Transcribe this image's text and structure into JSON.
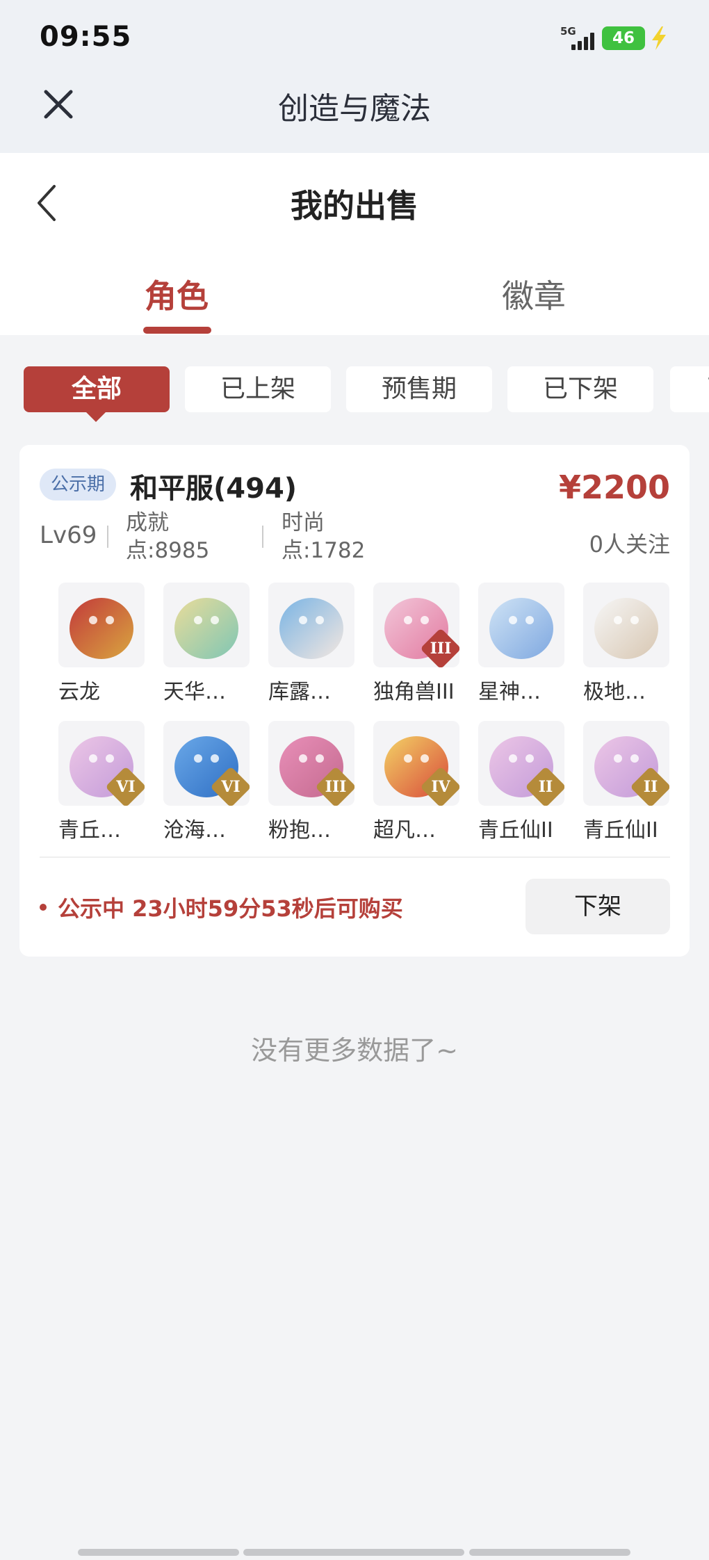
{
  "status": {
    "time": "09:55",
    "network": "5G",
    "battery": "46"
  },
  "mini_header": {
    "title": "创造与魔法"
  },
  "page": {
    "title": "我的出售"
  },
  "tabs": [
    {
      "label": "角色"
    },
    {
      "label": "徽章"
    }
  ],
  "filters": [
    {
      "label": "全部",
      "active": true
    },
    {
      "label": "已上架"
    },
    {
      "label": "预售期"
    },
    {
      "label": "已下架"
    },
    {
      "label": "已"
    }
  ],
  "listing": {
    "phase": "公示期",
    "server": "和平服(494)",
    "price": "¥2200",
    "followers": "0人关注",
    "level": "Lv69",
    "achievement": "成就点:8985",
    "fashion": "时尚点:1782",
    "pets": [
      {
        "name": "云龙",
        "colors": [
          "#c23a3a",
          "#d9a640"
        ],
        "icon": "dragon"
      },
      {
        "name": "天华…",
        "colors": [
          "#e9dc9a",
          "#7fc6b4"
        ],
        "icon": "goddess"
      },
      {
        "name": "库露…",
        "colors": [
          "#7ab4e4",
          "#f3e7e0"
        ],
        "icon": "sheep-girl"
      },
      {
        "name": "独角兽III",
        "colors": [
          "#f2c6d9",
          "#e27aa0"
        ],
        "icon": "unicorn",
        "rank": "III",
        "rank_color": "#b5403a"
      },
      {
        "name": "星神…",
        "colors": [
          "#cfe3f5",
          "#7fa8e0"
        ],
        "icon": "star-beast"
      },
      {
        "name": "极地…",
        "colors": [
          "#f6f6f6",
          "#d8c7b2"
        ],
        "icon": "polar-cat"
      },
      {
        "name": "青丘…",
        "colors": [
          "#ecc6e6",
          "#c39bd9"
        ],
        "icon": "fox-maiden",
        "rank": "VI",
        "rank_color": "#b58b3a"
      },
      {
        "name": "沧海…",
        "colors": [
          "#6aa8e8",
          "#2f6fc4"
        ],
        "icon": "sea-spirit",
        "rank": "VI",
        "rank_color": "#b58b3a"
      },
      {
        "name": "粉抱…",
        "colors": [
          "#e88fb8",
          "#c46a8f"
        ],
        "icon": "pink-bear",
        "rank": "III",
        "rank_color": "#b58b3a"
      },
      {
        "name": "超凡…",
        "colors": [
          "#f3d266",
          "#d84a3a"
        ],
        "icon": "golden-mecha",
        "rank": "IV",
        "rank_color": "#b58b3a"
      },
      {
        "name": "青丘仙II",
        "colors": [
          "#ecc6e6",
          "#c39bd9"
        ],
        "icon": "fox-maiden",
        "rank": "II",
        "rank_color": "#b58b3a"
      },
      {
        "name": "青丘仙II",
        "colors": [
          "#ecc6e6",
          "#c39bd9"
        ],
        "icon": "fox-maiden",
        "rank": "II",
        "rank_color": "#b58b3a"
      }
    ],
    "notice": "公示中 23小时59分53秒后可购买",
    "delist_label": "下架"
  },
  "footer": {
    "no_more": "没有更多数据了~"
  },
  "colors": {
    "accent": "#b5403a",
    "tag_bg": "#dfe8f7",
    "tag_text": "#4b6fa8"
  }
}
